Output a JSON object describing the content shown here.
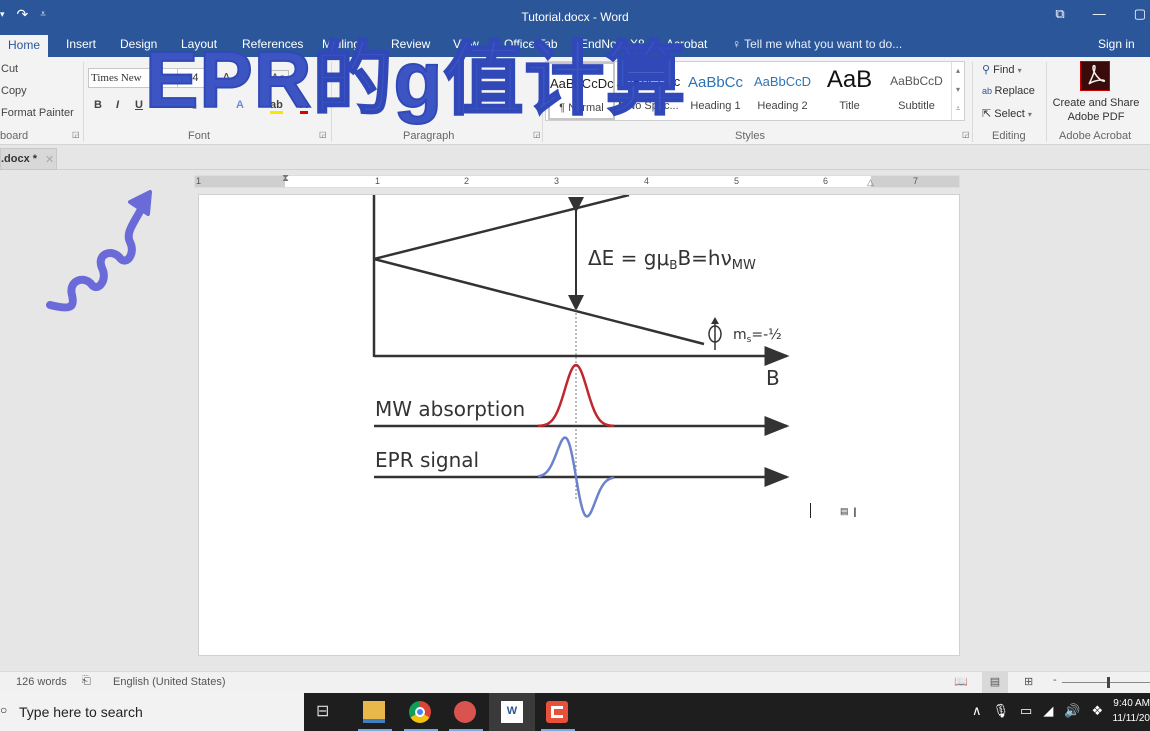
{
  "window": {
    "title": "Tutorial.docx - Word",
    "sign_in": "Sign in",
    "tell_me": "Tell me what you want to do..."
  },
  "tabs": [
    "Home",
    "Insert",
    "Design",
    "Layout",
    "References",
    "Mailings",
    "Review",
    "View",
    "Office Tab",
    "EndNote X8",
    "Acrobat"
  ],
  "ribbon": {
    "clipboard": {
      "cut": "Cut",
      "copy": "Copy",
      "format_painter": "Format Painter",
      "label": "board"
    },
    "font": {
      "name": "Times New",
      "size": "14",
      "label": "Font",
      "bold": "B",
      "italic": "I",
      "underline": "U",
      "strike": "abc",
      "subscript": "x₂"
    },
    "paragraph": {
      "label": "Paragraph"
    },
    "styles": {
      "label": "Styles",
      "items": [
        {
          "preview": "AaBbCcDc",
          "name": "¶ Normal"
        },
        {
          "preview": "AaBbCcDc",
          "name": "¶ No Spac..."
        },
        {
          "preview": "AaBbCc",
          "name": "Heading 1"
        },
        {
          "preview": "AaBbCcD",
          "name": "Heading 2"
        },
        {
          "preview": "AaB",
          "name": "Title"
        },
        {
          "preview": "AaBbCcD",
          "name": "Subtitle"
        }
      ]
    },
    "editing": {
      "find": "Find",
      "replace": "Replace",
      "select": "Select",
      "label": "Editing"
    },
    "acrobat": {
      "button": "Create and Share Adobe PDF",
      "label": "Adobe Acrobat"
    }
  },
  "doc_tab": {
    "name": ".docx *"
  },
  "ruler": {
    "numbers": [
      "1",
      "1",
      "2",
      "3",
      "4",
      "5",
      "6",
      "7"
    ]
  },
  "overlay_title": "EPR的g值计算",
  "figure": {
    "equation_main": "ΔE = gμ",
    "equation_sub_b": "B",
    "equation_mid": "B=hν",
    "equation_sub_mw": "MW",
    "ms_label": "m",
    "ms_sub": "s",
    "ms_value": "=-½",
    "axis_label": "B",
    "absorption_label": "MW absorption",
    "signal_label": "EPR signal",
    "absorption_color": "#c0282e",
    "signal_color": "#6b82cc"
  },
  "status": {
    "words": "126 words",
    "language": "English (United States)"
  },
  "taskbar": {
    "search_placeholder": "Type here to search",
    "apps": [
      "task-view",
      "file-explorer",
      "chrome",
      "pdf-reader",
      "word",
      "camtasia"
    ],
    "time": "9:40 AM",
    "date": "11/11/20"
  },
  "colors": {
    "word_blue": "#2b579a",
    "overlay": "#3d55c3",
    "arrow": "#6a6ad8"
  }
}
